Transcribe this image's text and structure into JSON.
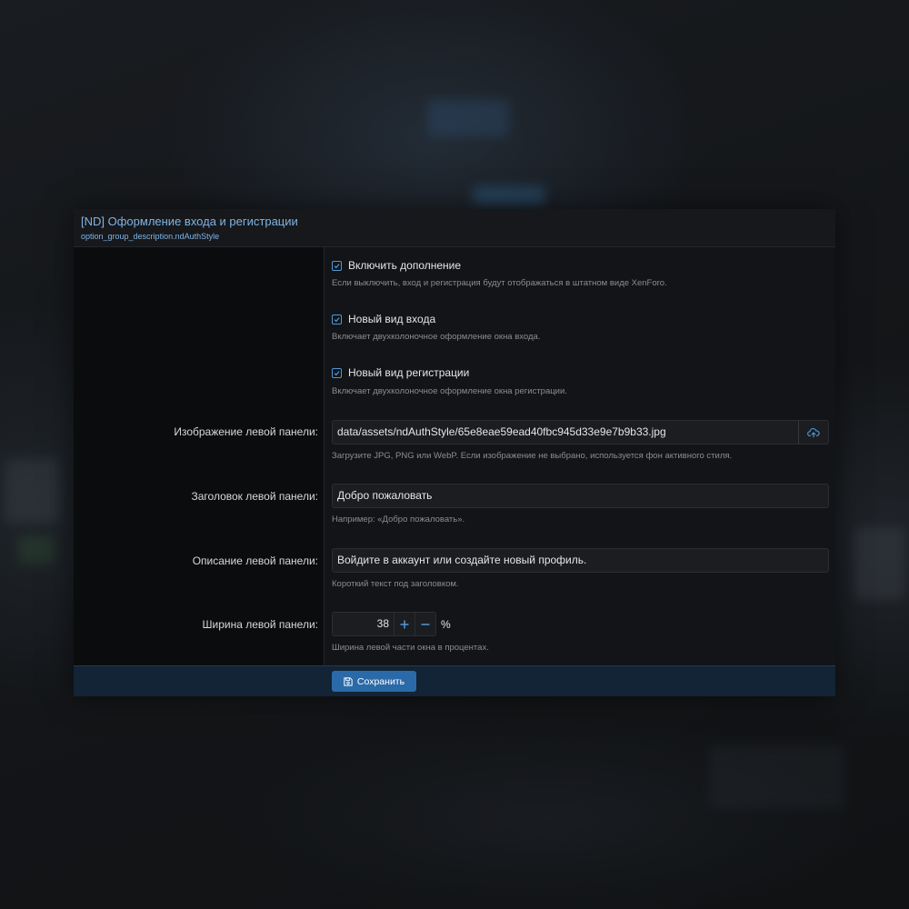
{
  "panel": {
    "title": "[ND] Оформление входа и регистрации",
    "subtitle": "option_group_description.ndAuthStyle"
  },
  "options": {
    "enable": {
      "label": "Включить дополнение",
      "checked": true,
      "hint": "Если выключить, вход и регистрация будут отображаться в штатном виде XenForo."
    },
    "new_login": {
      "label": "Новый вид входа",
      "checked": true,
      "hint": "Включает двухколоночное оформление окна входа."
    },
    "new_register": {
      "label": "Новый вид регистрации",
      "checked": true,
      "hint": "Включает двухколоночное оформление окна регистрации."
    },
    "left_image": {
      "label": "Изображение левой панели:",
      "value": "data/assets/ndAuthStyle/65e8eae59ead40fbc945d33e9e7b9b33.jpg",
      "hint": "Загрузите JPG, PNG или WebP. Если изображение не выбрано, используется фон активного стиля.",
      "upload_icon": "upload-cloud-icon"
    },
    "left_heading": {
      "label": "Заголовок левой панели:",
      "value": "Добро пожаловать",
      "hint": "Например: «Добро пожаловать»."
    },
    "left_description": {
      "label": "Описание левой панели:",
      "value": "Войдите в аккаунт или создайте новый профиль.",
      "hint": "Короткий текст под заголовком."
    },
    "left_width": {
      "label": "Ширина левой панели:",
      "value": "38",
      "unit": "%",
      "hint": "Ширина левой части окна в процентах."
    }
  },
  "footer": {
    "save_label": "Сохранить",
    "save_icon": "save-icon"
  },
  "colors": {
    "accent": "#4e98d8",
    "title": "#7fb4e6",
    "button": "#2b6aa8",
    "footer": "#122436"
  }
}
